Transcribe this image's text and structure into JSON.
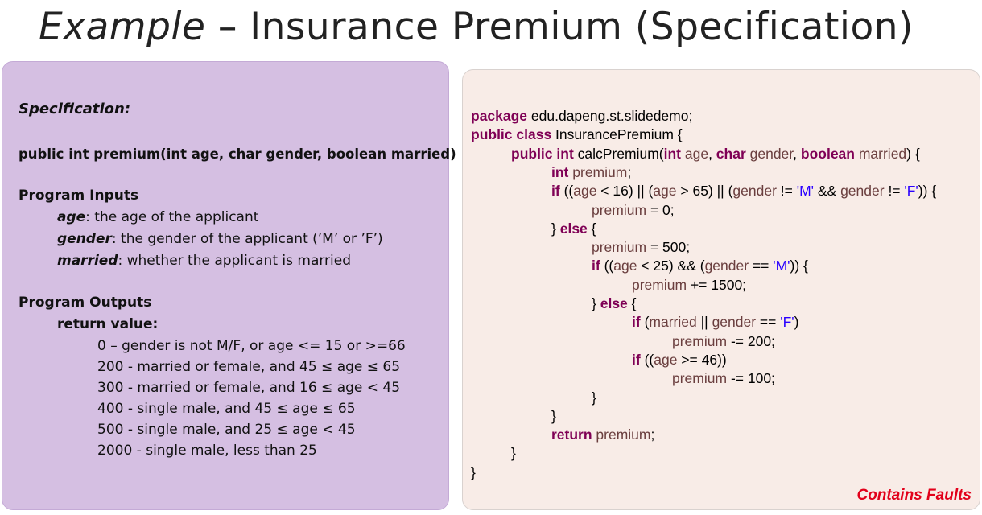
{
  "title": {
    "italic": "Example",
    "rest": " – Insurance Premium (Specification)"
  },
  "spec": {
    "heading": "Specification:",
    "signature": "public int premium(int age, char gender, boolean married)",
    "inputs_heading": "Program Inputs",
    "inputs": [
      {
        "name": "age",
        "desc": ": the age of the applicant"
      },
      {
        "name": "gender",
        "desc": ": the gender of the applicant (’M’ or ’F’)"
      },
      {
        "name": "married",
        "desc": ": whether the applicant is married"
      }
    ],
    "outputs_heading": "Program Outputs",
    "return_label": "return value:",
    "outputs": [
      "0 – gender is not M/F, or age <= 15 or >=66",
      "200 - married or female, and 45 ≤ age ≤ 65",
      "300 - married or female, and 16 ≤ age < 45",
      "400 - single male, and 45 ≤ age ≤ 65",
      "500 - single male, and 25 ≤ age < 45",
      "2000 - single male, less than 25"
    ]
  },
  "code": {
    "lines": [
      [
        [
          "kw",
          "package"
        ],
        [
          "p",
          " edu.dapeng.st.slidedemo;"
        ]
      ],
      [
        [
          "kw",
          "public class"
        ],
        [
          "p",
          " InsurancePremium {"
        ]
      ],
      [
        [
          "kw",
          "public int"
        ],
        [
          "p",
          " calcPremium("
        ],
        [
          "kw",
          "int"
        ],
        [
          "vr",
          " age"
        ],
        [
          "p",
          ", "
        ],
        [
          "kw",
          "char"
        ],
        [
          "vr",
          " gender"
        ],
        [
          "p",
          ", "
        ],
        [
          "kw",
          "boolean"
        ],
        [
          "vr",
          " married"
        ],
        [
          "p",
          ") {"
        ]
      ],
      [
        [
          "kw",
          "int"
        ],
        [
          "vr",
          " premium"
        ],
        [
          "p",
          ";"
        ]
      ],
      [
        [
          "kw",
          "if"
        ],
        [
          "p",
          " (("
        ],
        [
          "vr",
          "age"
        ],
        [
          "p",
          " < 16) || ("
        ],
        [
          "vr",
          "age"
        ],
        [
          "p",
          " > 65) || ("
        ],
        [
          "vr",
          "gender"
        ],
        [
          "p",
          " != "
        ],
        [
          "str",
          "'M'"
        ],
        [
          "p",
          " && "
        ],
        [
          "vr",
          "gender"
        ],
        [
          "p",
          " != "
        ],
        [
          "str",
          "'F'"
        ],
        [
          "p",
          ")) {"
        ]
      ],
      [
        [
          "vr",
          "premium"
        ],
        [
          "p",
          " = 0;"
        ]
      ],
      [
        [
          "p",
          "} "
        ],
        [
          "kw",
          "else"
        ],
        [
          "p",
          " {"
        ]
      ],
      [
        [
          "vr",
          "premium"
        ],
        [
          "p",
          " = 500;"
        ]
      ],
      [
        [
          "kw",
          "if"
        ],
        [
          "p",
          " (("
        ],
        [
          "vr",
          "age"
        ],
        [
          "p",
          " < 25) && ("
        ],
        [
          "vr",
          "gender"
        ],
        [
          "p",
          " == "
        ],
        [
          "str",
          "'M'"
        ],
        [
          "p",
          ")) {"
        ]
      ],
      [
        [
          "vr",
          "premium"
        ],
        [
          "p",
          " += 1500;"
        ]
      ],
      [
        [
          "p",
          "} "
        ],
        [
          "kw",
          "else"
        ],
        [
          "p",
          " {"
        ]
      ],
      [
        [
          "kw",
          "if"
        ],
        [
          "p",
          " ("
        ],
        [
          "vr",
          "married"
        ],
        [
          "p",
          " || "
        ],
        [
          "vr",
          "gender"
        ],
        [
          "p",
          " == "
        ],
        [
          "str",
          "'F'"
        ],
        [
          "p",
          ")"
        ]
      ],
      [
        [
          "vr",
          "premium"
        ],
        [
          "p",
          " -= 200;"
        ]
      ],
      [
        [
          "kw",
          "if"
        ],
        [
          "p",
          " (("
        ],
        [
          "vr",
          "age"
        ],
        [
          "p",
          " >= 46))"
        ]
      ],
      [
        [
          "vr",
          "premium"
        ],
        [
          "p",
          " -= 100;"
        ]
      ],
      [
        [
          "p",
          "}"
        ]
      ],
      [
        [
          "p",
          "}"
        ]
      ],
      [
        [
          "kw",
          "return"
        ],
        [
          "vr",
          " premium"
        ],
        [
          "p",
          ";"
        ]
      ],
      [
        [
          "p",
          "}"
        ]
      ],
      [
        [
          "p",
          "}"
        ]
      ]
    ],
    "note": "Contains Faults"
  }
}
